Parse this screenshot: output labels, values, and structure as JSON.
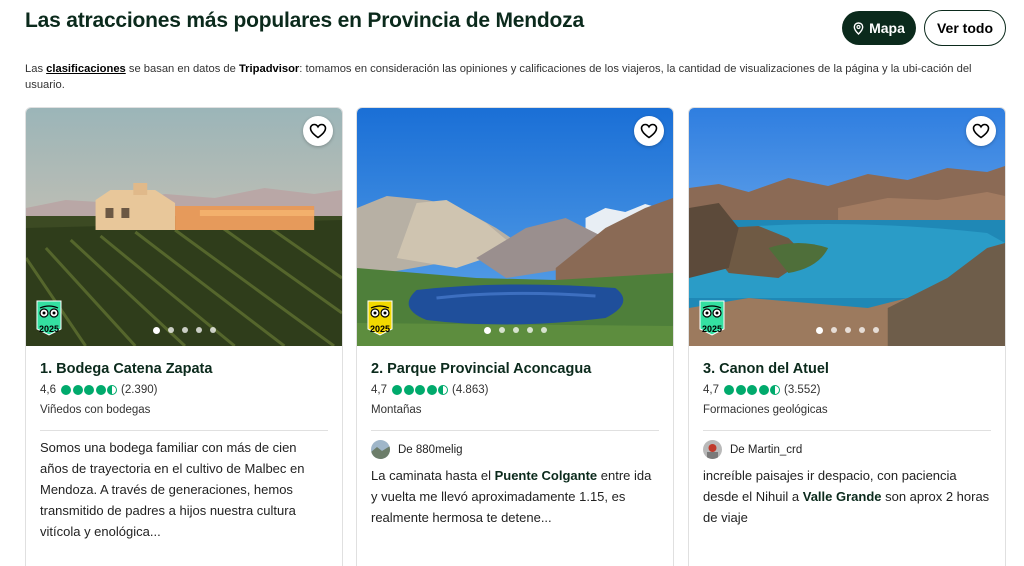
{
  "header": {
    "title": "Las atracciones más populares en Provincia de Mendoza",
    "map_label": "Mapa",
    "see_all_label": "Ver todo"
  },
  "subtitle": {
    "prefix": "Las ",
    "link": "clasificaciones",
    "middle": " se basan en datos de ",
    "brand": "Tripadvisor",
    "rest": ": tomamos en consideración las opiniones y calificaciones de los viajeros, la cantidad de visualizaciones de la página y la ubi-cación del usuario."
  },
  "colors": {
    "brand_dark": "#0b2a1c",
    "bubble_green": "#00aa6c",
    "badge_green": "#34e0a1",
    "badge_yellow": "#f2d900"
  },
  "cards": [
    {
      "name": "1. Bodega Catena Zapata",
      "rating": "4,6",
      "bubbles": 4.5,
      "reviews": "(2.390)",
      "category": "Viñedos con bodegas",
      "badge_year": "2025",
      "badge_icon": "travelers-choice-icon",
      "description": "Somos una bodega familiar con más de cien años de trayectoria en el cultivo de Malbec en Mendoza. A través de generaciones, hemos transmitido de padres a hijos nuestra cultura vitícola y enológica..."
    },
    {
      "name": "2. Parque Provincial Aconcagua",
      "rating": "4,7",
      "bubbles": 4.5,
      "reviews": "(4.863)",
      "category": "Montañas",
      "badge_year": "2025",
      "badge_icon": "travelers-choice-best-icon",
      "review_user": "De 880melig",
      "review_before": "La caminata hasta el ",
      "review_bold": "Puente Colgante",
      "review_after": " entre ida y vuelta me llevó aproximadamente 1.15, es realmente hermosa te detene..."
    },
    {
      "name": "3. Canon del Atuel",
      "rating": "4,7",
      "bubbles": 4.5,
      "reviews": "(3.552)",
      "category": "Formaciones geológicas",
      "badge_year": "2025",
      "badge_icon": "travelers-choice-icon",
      "review_user": "De Martin_crd",
      "review_before": "increíble paisajes ir despacio, con paciencia desde el Nihuil a ",
      "review_bold": "Valle Grande",
      "review_after": " son aprox 2 horas de viaje"
    }
  ]
}
